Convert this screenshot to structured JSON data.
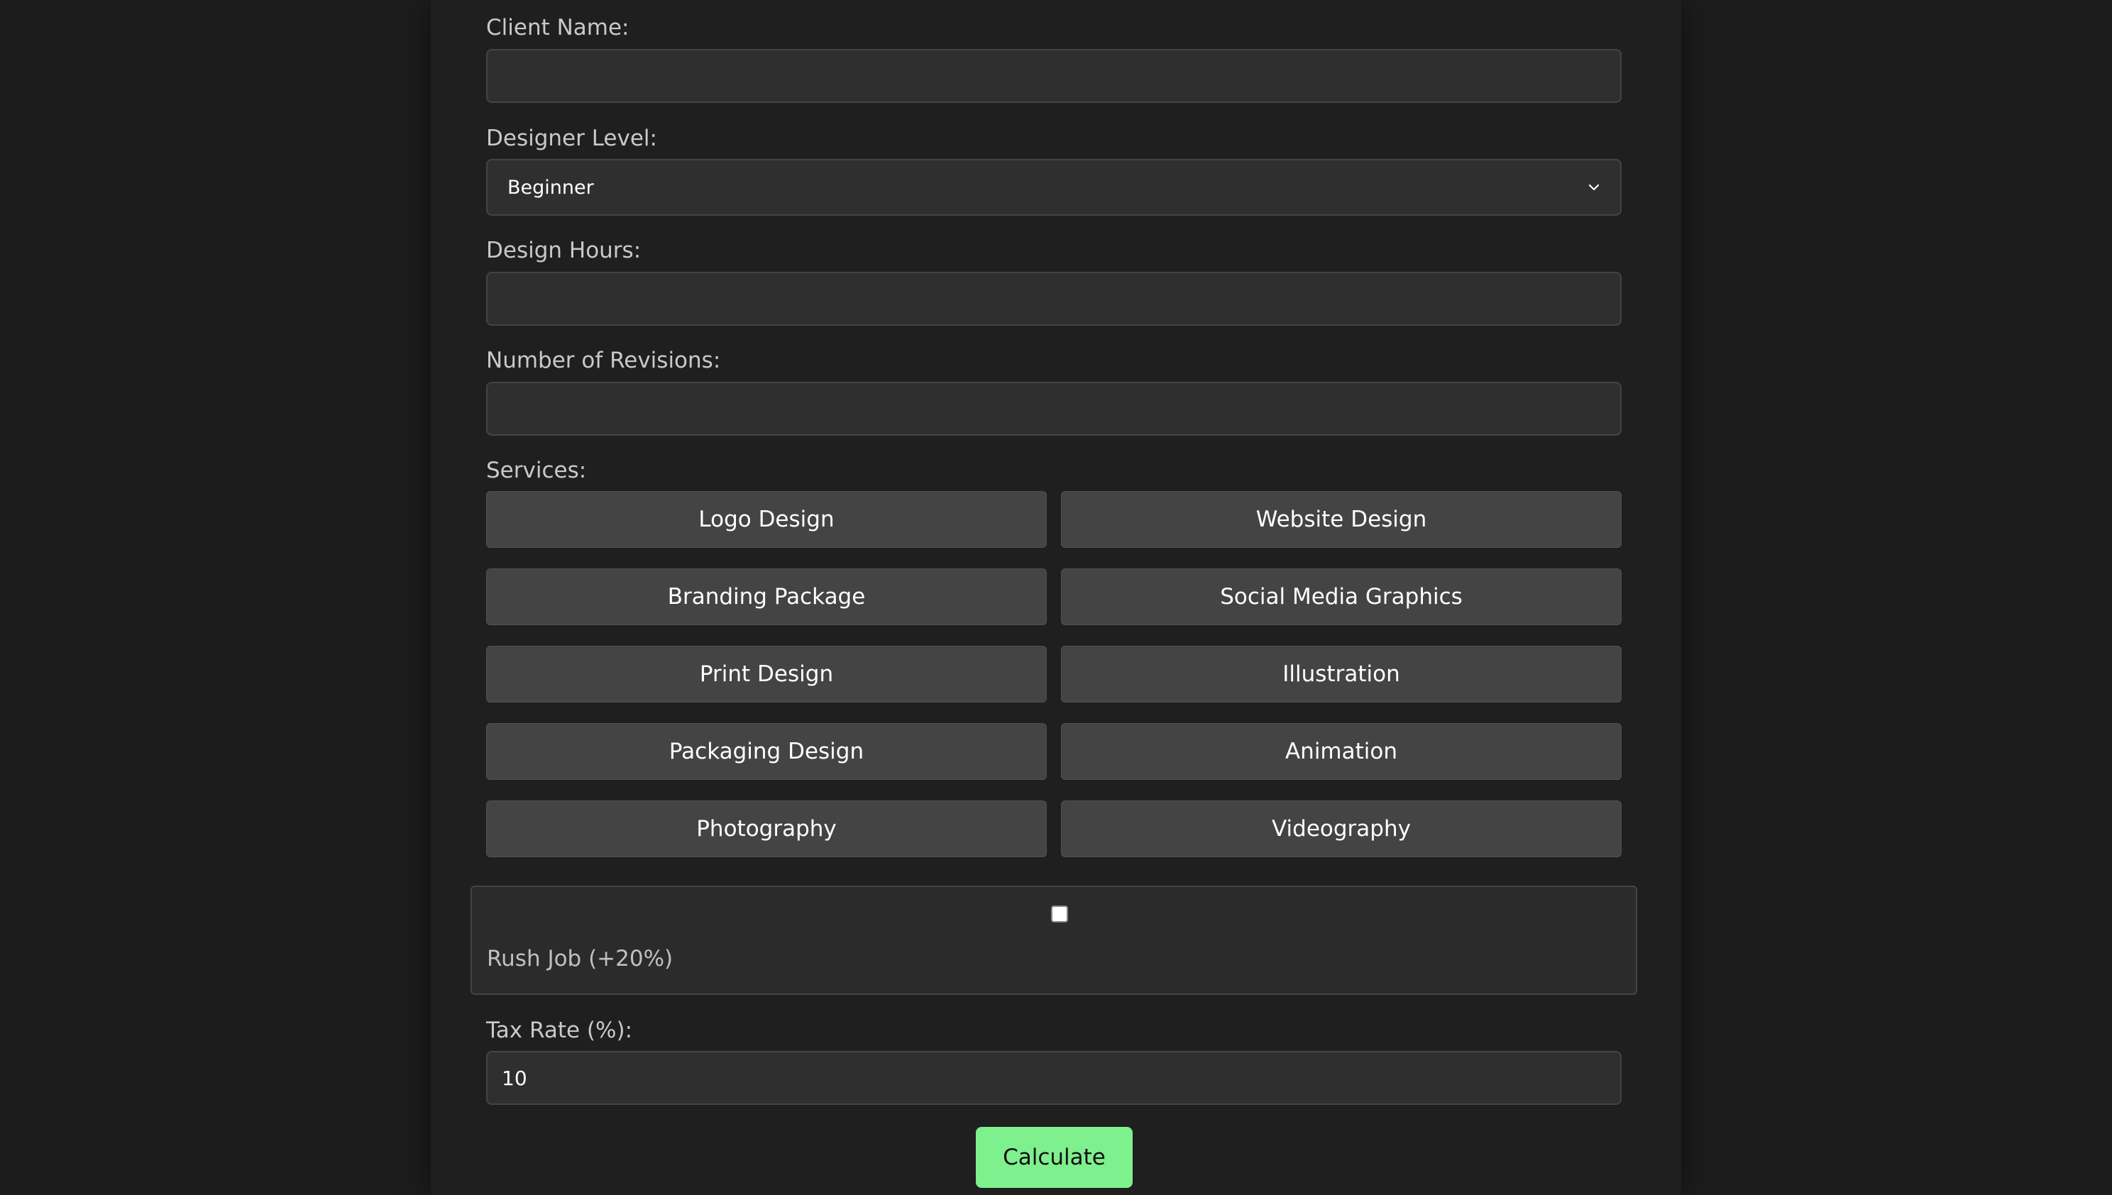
{
  "form": {
    "client_name_label": "Client Name:",
    "client_name_value": "",
    "designer_level_label": "Designer Level:",
    "designer_level_selected": "Beginner",
    "design_hours_label": "Design Hours:",
    "design_hours_value": "",
    "revisions_label": "Number of Revisions:",
    "revisions_value": "",
    "services_label": "Services:",
    "services": [
      "Logo Design",
      "Website Design",
      "Branding Package",
      "Social Media Graphics",
      "Print Design",
      "Illustration",
      "Packaging Design",
      "Animation",
      "Photography",
      "Videography"
    ],
    "rush_job_label": "Rush Job (+20%)",
    "rush_job_checked": false,
    "tax_rate_label": "Tax Rate (%):",
    "tax_rate_value": "10",
    "calculate_label": "Calculate"
  },
  "colors": {
    "background": "#1c1c1c",
    "panel": "#1f1f1f",
    "input_bg": "#2f2f2f",
    "service_button_bg": "#444444",
    "accent": "#7ef08e"
  }
}
